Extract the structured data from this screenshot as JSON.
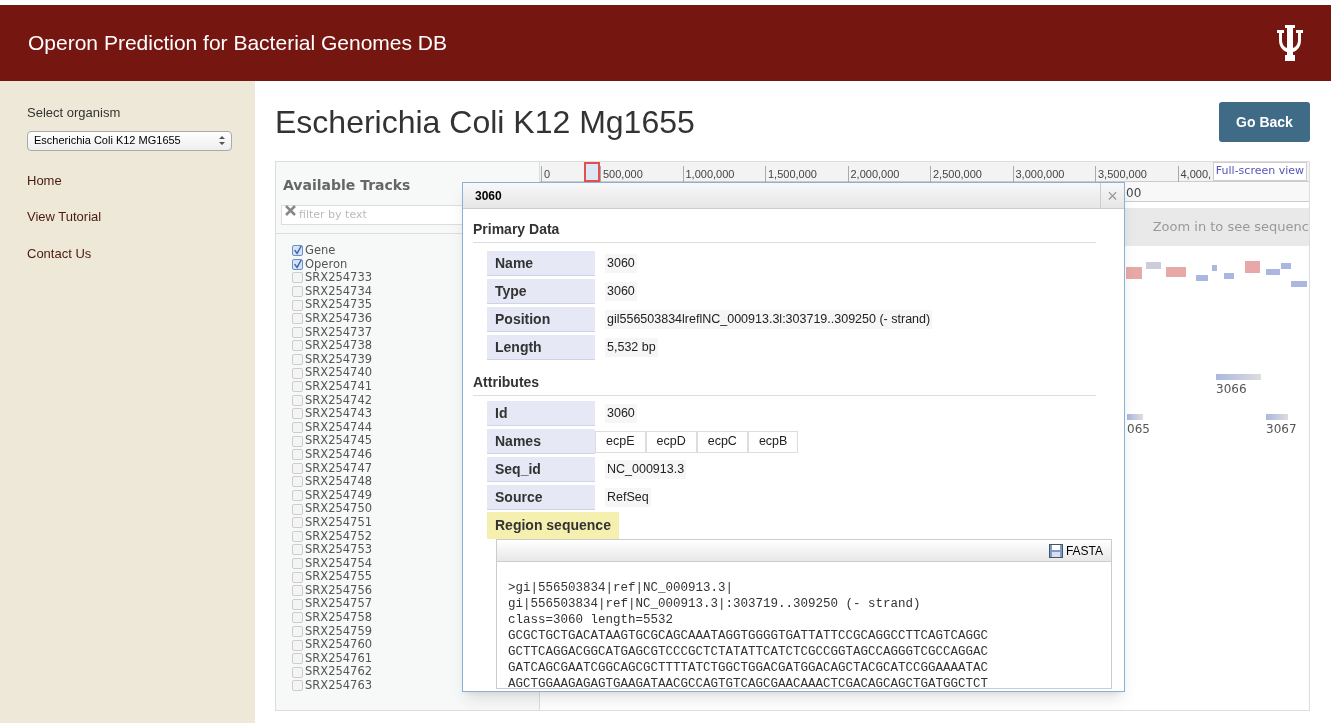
{
  "header": {
    "title": "Operon Prediction for Bacterial Genomes DB"
  },
  "sidebar": {
    "select_label": "Select organism",
    "select_value": "Escherichia Coli K12 MG1655",
    "nav": [
      "Home",
      "View Tutorial",
      "Contact Us"
    ]
  },
  "page_title": "Escherichia Coli K12 Mg1655",
  "go_back": "Go Back",
  "tracks_panel": {
    "title": "Available Tracks",
    "filter_placeholder": "filter by text",
    "tracks": [
      {
        "label": "Gene",
        "checked": true
      },
      {
        "label": "Operon",
        "checked": true
      },
      {
        "label": "SRX254733",
        "checked": false
      },
      {
        "label": "SRX254734",
        "checked": false
      },
      {
        "label": "SRX254735",
        "checked": false
      },
      {
        "label": "SRX254736",
        "checked": false
      },
      {
        "label": "SRX254737",
        "checked": false
      },
      {
        "label": "SRX254738",
        "checked": false
      },
      {
        "label": "SRX254739",
        "checked": false
      },
      {
        "label": "SRX254740",
        "checked": false
      },
      {
        "label": "SRX254741",
        "checked": false
      },
      {
        "label": "SRX254742",
        "checked": false
      },
      {
        "label": "SRX254743",
        "checked": false
      },
      {
        "label": "SRX254744",
        "checked": false
      },
      {
        "label": "SRX254745",
        "checked": false
      },
      {
        "label": "SRX254746",
        "checked": false
      },
      {
        "label": "SRX254747",
        "checked": false
      },
      {
        "label": "SRX254748",
        "checked": false
      },
      {
        "label": "SRX254749",
        "checked": false
      },
      {
        "label": "SRX254750",
        "checked": false
      },
      {
        "label": "SRX254751",
        "checked": false
      },
      {
        "label": "SRX254752",
        "checked": false
      },
      {
        "label": "SRX254753",
        "checked": false
      },
      {
        "label": "SRX254754",
        "checked": false
      },
      {
        "label": "SRX254755",
        "checked": false
      },
      {
        "label": "SRX254756",
        "checked": false
      },
      {
        "label": "SRX254757",
        "checked": false
      },
      {
        "label": "SRX254758",
        "checked": false
      },
      {
        "label": "SRX254759",
        "checked": false
      },
      {
        "label": "SRX254760",
        "checked": false
      },
      {
        "label": "SRX254761",
        "checked": false
      },
      {
        "label": "SRX254762",
        "checked": false
      },
      {
        "label": "SRX254763",
        "checked": false
      }
    ]
  },
  "genome_view": {
    "ruler_labels": [
      "0",
      "500,000",
      "1,000,000",
      "1,500,000",
      "2,000,000",
      "2,500,000",
      "3,000,000",
      "3,500,000",
      "4,000,"
    ],
    "ruler2_label": "00",
    "fullscreen_link": "Full-screen view",
    "sequence_hint": "Zoom in to see sequenc",
    "features": [
      {
        "label": "065"
      },
      {
        "label": "3066"
      },
      {
        "label": "3067"
      }
    ]
  },
  "dialog": {
    "title": "3060",
    "close": "×",
    "primary_heading": "Primary Data",
    "primary": [
      {
        "key": "Name",
        "value": "3060"
      },
      {
        "key": "Type",
        "value": "3060"
      },
      {
        "key": "Position",
        "value": "gil556503834lreflNC_000913.3l:303719..309250 (- strand)"
      },
      {
        "key": "Length",
        "value": "5,532 bp"
      }
    ],
    "attributes_heading": "Attributes",
    "attributes": [
      {
        "key": "Id",
        "values": [
          "3060"
        ],
        "kind": "text"
      },
      {
        "key": "Names",
        "values": [
          "ecpE",
          "ecpD",
          "ecpC",
          "ecpB"
        ],
        "kind": "list"
      },
      {
        "key": "Seq_id",
        "values": [
          "NC_000913.3"
        ],
        "kind": "text"
      },
      {
        "key": "Source",
        "values": [
          "RefSeq"
        ],
        "kind": "text"
      }
    ],
    "region_heading": "Region sequence",
    "fasta_button": "FASTA",
    "sequence_lines": [
      ">gi|556503834|ref|NC_000913.3|",
      "gi|556503834|ref|NC_000913.3|:303719..309250 (- strand)",
      "class=3060 length=5532",
      "GCGCTGCTGACATAAGTGCGCAGCAAATAGGTGGGGTGATTATTCCGCAGGCCTTCAGTCAGGC",
      "GCTTCAGGACGGCATGAGCGTCCCGCTCTATATTCATCTCGCCGGTAGCCAGGGTCGCCAGGAC",
      "GATCAGCGAATCGGCAGCGCTTTTATCTGGCTGGACGATGGACAGCTACGCATCCGGAAAATAC",
      "AGCTGGAAGAGAGTGAAGATAACGCCAGTGTCAGCGAACAAACTCGACAGCAGCTGATGGCTCT"
    ]
  }
}
